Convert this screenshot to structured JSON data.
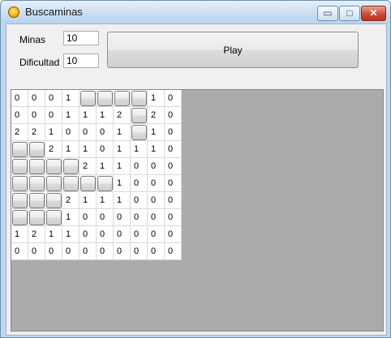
{
  "window": {
    "title": "Buscaminas",
    "controls": {
      "minimize": "▭",
      "maximize": "□",
      "close": "✕"
    }
  },
  "form": {
    "minas_label": "Minas",
    "minas_value": "10",
    "dificultad_label": "Dificultad",
    "dificultad_value": "10",
    "play_label": "Play"
  },
  "board": {
    "rows": [
      [
        "0",
        "0",
        "0",
        "1",
        "#",
        "#",
        "#",
        "#",
        "1",
        "0"
      ],
      [
        "0",
        "0",
        "0",
        "1",
        "1",
        "1",
        "2",
        "#",
        "2",
        "0"
      ],
      [
        "2",
        "2",
        "1",
        "0",
        "0",
        "0",
        "1",
        "#",
        "1",
        "0"
      ],
      [
        "#",
        "#",
        "2",
        "1",
        "1",
        "0",
        "1",
        "1",
        "1",
        "0"
      ],
      [
        "#",
        "#",
        "#",
        "#",
        "2",
        "1",
        "1",
        "0",
        "0",
        "0"
      ],
      [
        "#",
        "#",
        "#",
        "#",
        "#",
        "#",
        "1",
        "0",
        "0",
        "0"
      ],
      [
        "#",
        "#",
        "#",
        "2",
        "1",
        "1",
        "1",
        "0",
        "0",
        "0"
      ],
      [
        "#",
        "#",
        "#",
        "1",
        "0",
        "0",
        "0",
        "0",
        "0",
        "0"
      ],
      [
        "1",
        "2",
        "1",
        "1",
        "0",
        "0",
        "0",
        "0",
        "0",
        "0"
      ],
      [
        "0",
        "0",
        "0",
        "0",
        "0",
        "0",
        "0",
        "0",
        "0",
        "0"
      ]
    ]
  },
  "colors": {
    "field_background": "#ababab",
    "title_bar": "#c7dcf2",
    "close_button": "#cc4a36"
  }
}
